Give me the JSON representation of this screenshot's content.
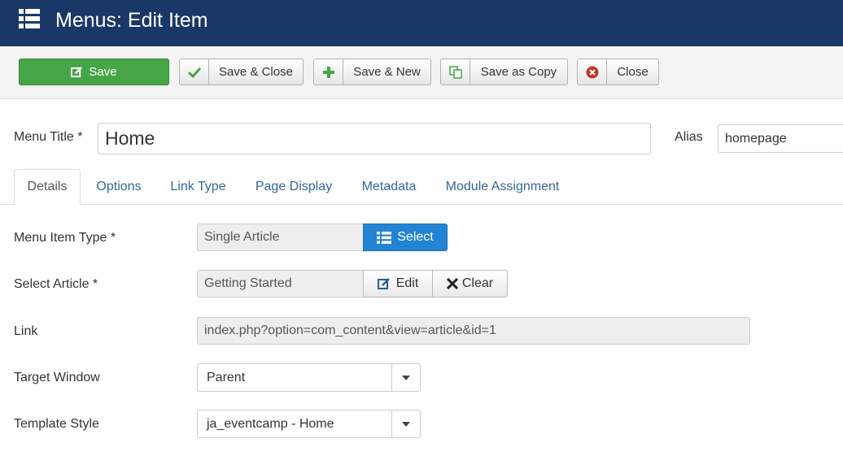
{
  "header": {
    "title": "Menus: Edit Item",
    "icon": "list-menu-icon"
  },
  "toolbar": {
    "save": "Save",
    "save_close": "Save & Close",
    "save_new": "Save & New",
    "save_copy": "Save as Copy",
    "close": "Close"
  },
  "title_row": {
    "menu_title_label": "Menu Title *",
    "menu_title_value": "Home",
    "alias_label": "Alias",
    "alias_value": "homepage"
  },
  "tabs": [
    {
      "label": "Details",
      "active": true
    },
    {
      "label": "Options"
    },
    {
      "label": "Link Type"
    },
    {
      "label": "Page Display"
    },
    {
      "label": "Metadata"
    },
    {
      "label": "Module Assignment"
    }
  ],
  "form": {
    "menu_item_type_label": "Menu Item Type *",
    "menu_item_type_value": "Single Article",
    "select_button": "Select",
    "select_article_label": "Select Article *",
    "select_article_value": "Getting Started",
    "edit_button": "Edit",
    "clear_button": "Clear",
    "link_label": "Link",
    "link_value": "index.php?option=com_content&view=article&id=1",
    "target_window_label": "Target Window",
    "target_window_value": "Parent",
    "template_style_label": "Template Style",
    "template_style_value": "ja_eventcamp - Home"
  },
  "colors": {
    "header_bg": "#1a3867",
    "save_green": "#46a546",
    "select_blue": "#2384d3",
    "close_red": "#bd362f",
    "tab_link": "#336699"
  }
}
